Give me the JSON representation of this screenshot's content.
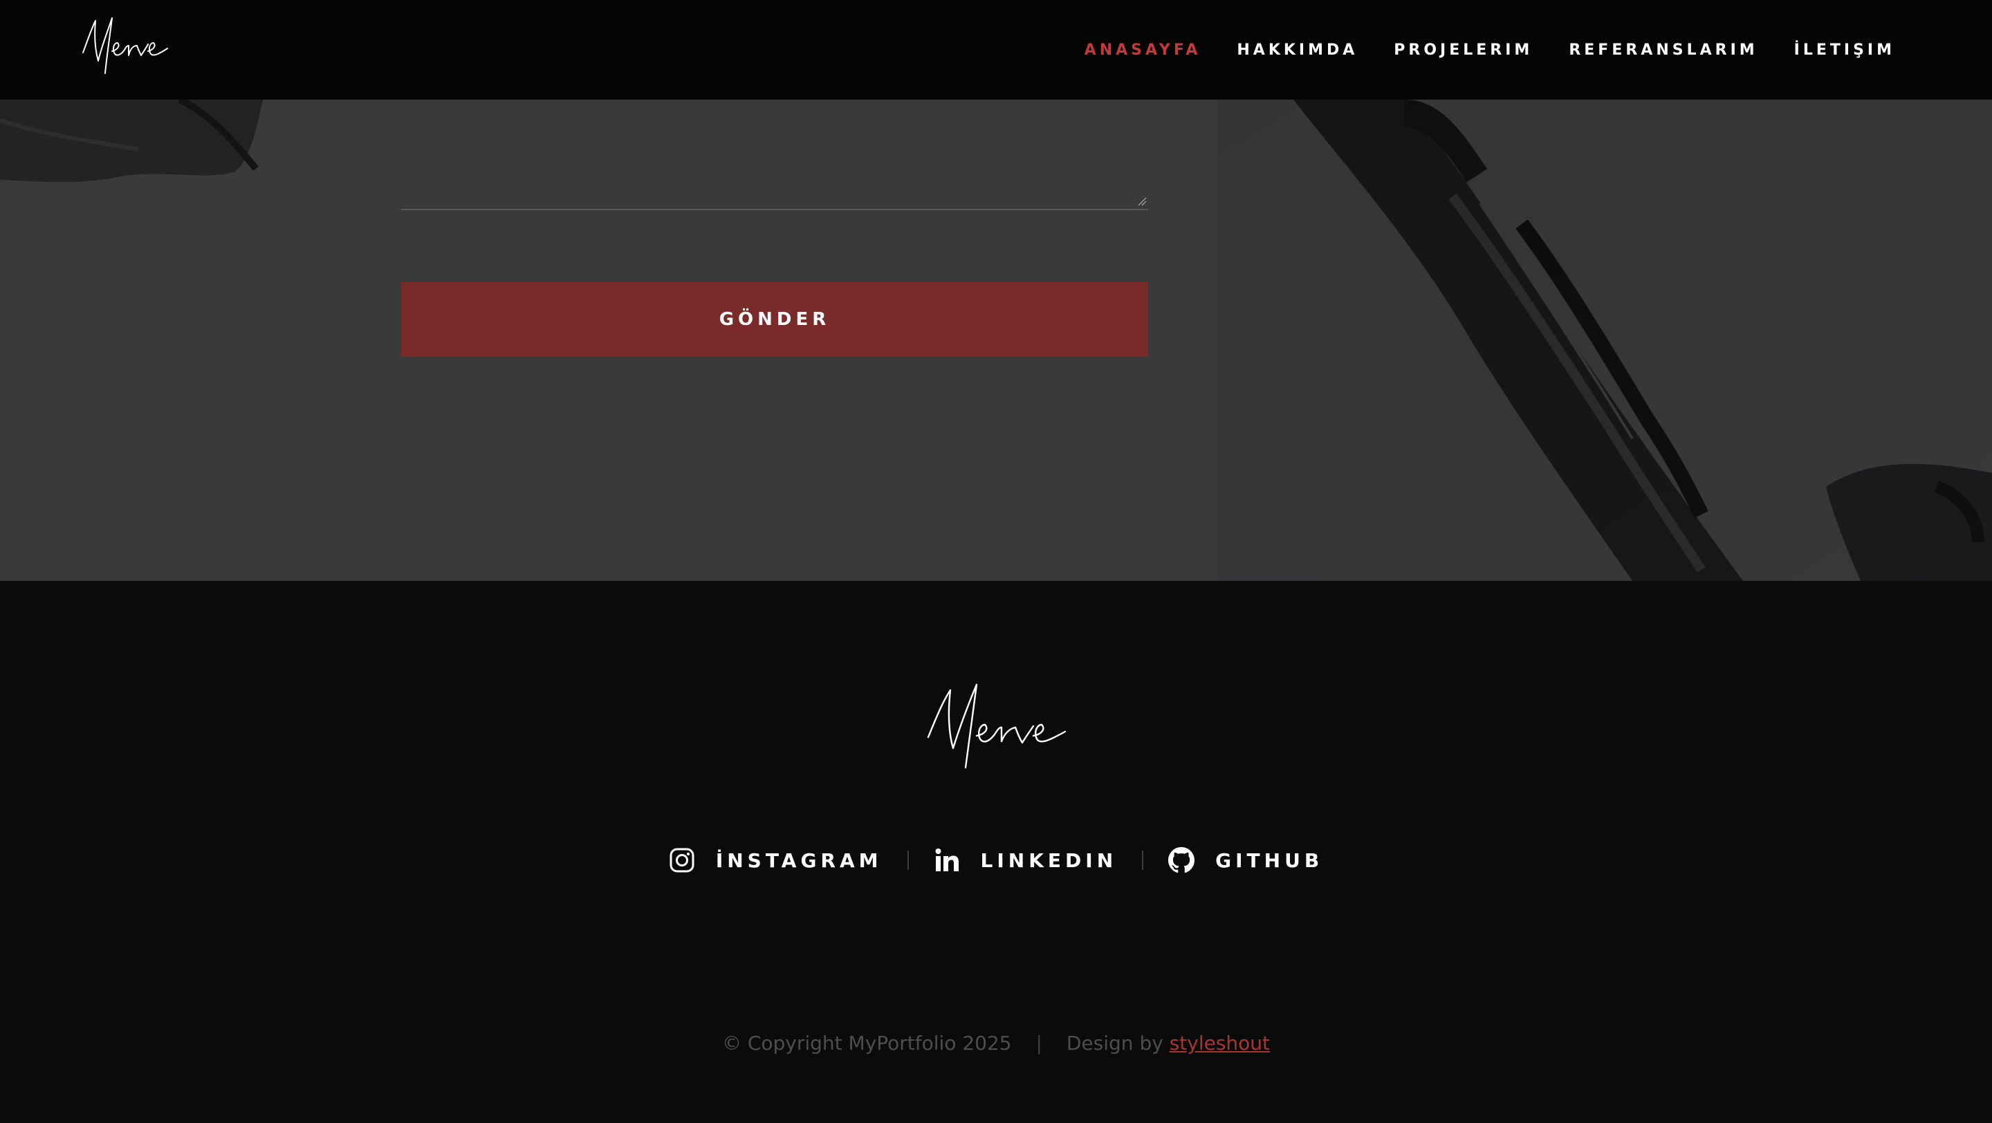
{
  "header": {
    "logo_text": "Merve",
    "nav": [
      {
        "label": "ANASAYFA",
        "active": true
      },
      {
        "label": "HAKKIMDA",
        "active": false
      },
      {
        "label": "PROJELERIM",
        "active": false
      },
      {
        "label": "REFERANSLARIM",
        "active": false
      },
      {
        "label": "İLETIŞIM",
        "active": false
      }
    ]
  },
  "contact": {
    "message_value": "",
    "submit_label": "GÖNDER"
  },
  "footer": {
    "logo_text": "Merve",
    "socials": [
      {
        "label": "İNSTAGRAM",
        "icon": "instagram-icon"
      },
      {
        "label": "LINKEDIN",
        "icon": "linkedin-icon"
      },
      {
        "label": "GITHUB",
        "icon": "github-icon"
      }
    ],
    "copyright": "© Copyright MyPortfolio 2025",
    "design_by": "Design by",
    "designer": "styleshout"
  },
  "colors": {
    "accent": "#c43a3a",
    "button": "#7b2b29",
    "header_bg": "#050505",
    "section_bg": "#3a3a3b",
    "footer_bg": "#0c0b0c"
  }
}
